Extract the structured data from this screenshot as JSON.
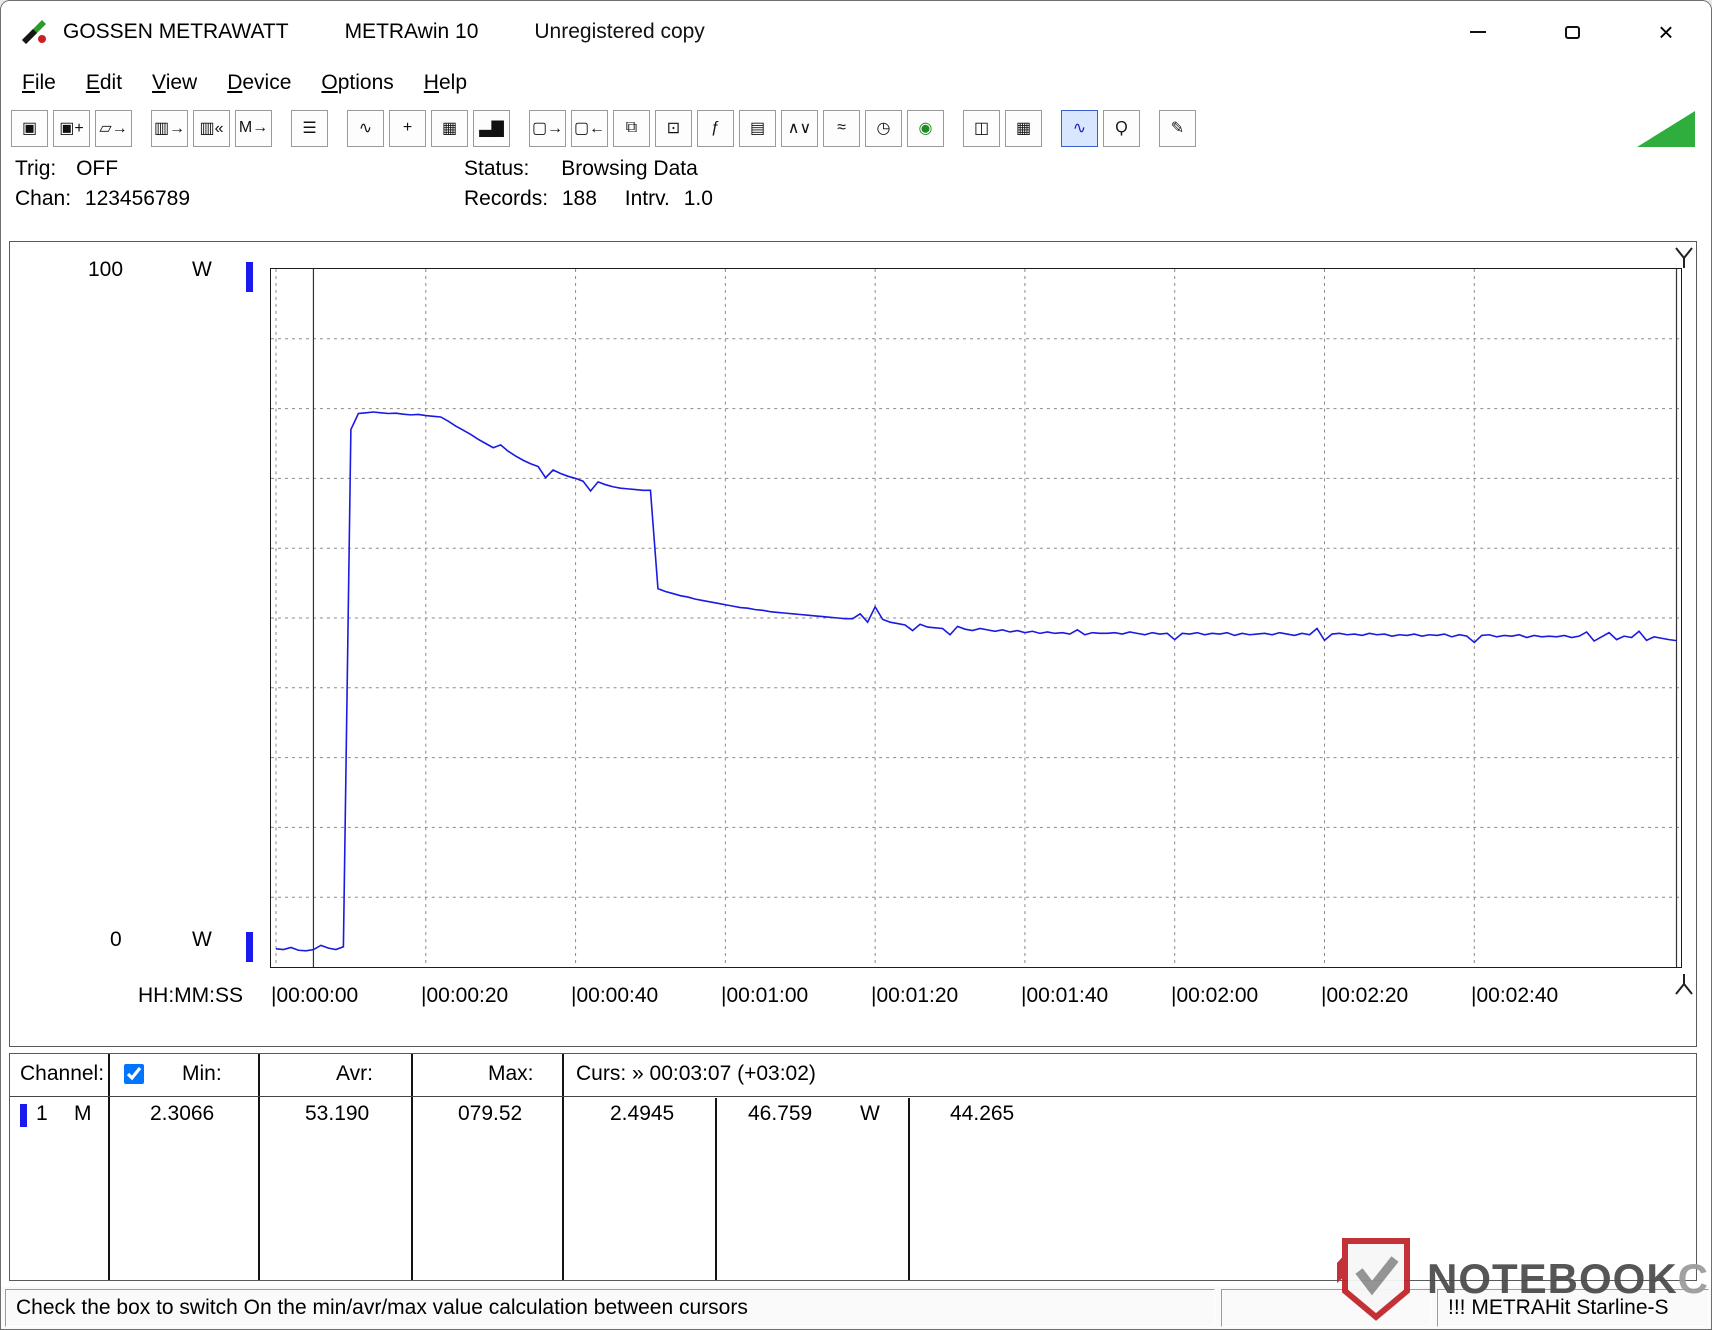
{
  "window": {
    "brand": "GOSSEN METRAWATT",
    "app": "METRAwin 10",
    "note": "Unregistered copy",
    "close_glyph": "×"
  },
  "menu": {
    "items": [
      "File",
      "Edit",
      "View",
      "Device",
      "Options",
      "Help"
    ]
  },
  "toolbar": {
    "groups": [
      {
        "buttons": [
          {
            "name": "save",
            "glyph": "▣"
          },
          {
            "name": "save-as",
            "glyph": "▣+"
          },
          {
            "name": "open-file",
            "glyph": "▱→"
          }
        ]
      },
      {
        "buttons": [
          {
            "name": "export-device",
            "glyph": "▥→"
          },
          {
            "name": "export-30k",
            "glyph": "▥«"
          },
          {
            "name": "export-memory",
            "glyph": "M→"
          }
        ]
      },
      {
        "buttons": [
          {
            "name": "keyboard",
            "glyph": "☰"
          }
        ]
      },
      {
        "buttons": [
          {
            "name": "chart-line-view",
            "glyph": "∿"
          },
          {
            "name": "crosshair-view",
            "glyph": "+"
          },
          {
            "name": "table-view",
            "glyph": "▦"
          },
          {
            "name": "bar-chart-view",
            "glyph": "▃▇"
          }
        ]
      },
      {
        "buttons": [
          {
            "name": "window-export",
            "glyph": "▢→"
          },
          {
            "name": "window-import",
            "glyph": "▢←"
          },
          {
            "name": "window-cascade",
            "glyph": "⧉"
          },
          {
            "name": "monitor",
            "glyph": "⊡"
          },
          {
            "name": "formula",
            "glyph": "ƒ"
          },
          {
            "name": "device-read",
            "glyph": "▤"
          },
          {
            "name": "wave-split",
            "glyph": "∧∨"
          },
          {
            "name": "wave",
            "glyph": "≈"
          },
          {
            "name": "device-timer",
            "glyph": "◷"
          },
          {
            "name": "device-status",
            "glyph": "◉",
            "color": "#1f8a1f"
          }
        ]
      },
      {
        "buttons": [
          {
            "name": "print-preview",
            "glyph": "◫"
          },
          {
            "name": "print",
            "glyph": "▦"
          }
        ]
      },
      {
        "buttons": [
          {
            "name": "zoom-wave",
            "glyph": "∿",
            "color": "#1a1acc",
            "active": true
          },
          {
            "name": "zoom-search",
            "glyph": "Ϙ"
          }
        ]
      },
      {
        "buttons": [
          {
            "name": "annotation",
            "glyph": "✎"
          }
        ]
      }
    ]
  },
  "info": {
    "trig_label": "Trig:",
    "trig_value": "OFF",
    "chan_label": "Chan:",
    "chan_value": "123456789",
    "status_label": "Status:",
    "status_value": "Browsing Data",
    "records_label": "Records:",
    "records_value": "188",
    "interval_label": "Intrv.",
    "interval_value": "1.0"
  },
  "chart": {
    "y_top_value": "100",
    "y_top_unit": "W",
    "y_bottom_value": "0",
    "y_bottom_unit": "W",
    "x_axis_label": "HH:MM:SS",
    "line_color": "#1a1ae0",
    "grid_color": "#8a8a8a"
  },
  "chart_data": {
    "type": "line",
    "title": "",
    "xlabel": "HH:MM:SS",
    "ylabel": "W",
    "ylim": [
      0,
      100
    ],
    "xlim_seconds": [
      0,
      187
    ],
    "grid": true,
    "x_tick_seconds": [
      0,
      20,
      40,
      60,
      80,
      100,
      120,
      140,
      160
    ],
    "x_tick_labels": [
      "00:00:00",
      "00:00:20",
      "00:00:40",
      "00:01:00",
      "00:01:20",
      "00:01:40",
      "00:02:00",
      "00:02:20",
      "00:02:40"
    ],
    "interval_s": 1,
    "cursors": {
      "cursor1_s": 5,
      "cursor2_s": 187
    },
    "series": [
      {
        "name": "Channel 1 power (W)",
        "values_w": [
          2.6,
          2.5,
          2.8,
          2.4,
          2.31,
          2.49,
          3.1,
          2.7,
          2.5,
          2.9,
          77.0,
          79.3,
          79.4,
          79.52,
          79.4,
          79.3,
          79.35,
          79.2,
          79.1,
          79.15,
          79.0,
          78.9,
          78.8,
          78.2,
          77.5,
          76.9,
          76.3,
          75.6,
          75.0,
          74.4,
          74.8,
          73.9,
          73.2,
          72.6,
          72.1,
          71.7,
          70.1,
          71.2,
          70.7,
          70.3,
          70.0,
          69.6,
          68.2,
          69.5,
          69.1,
          68.8,
          68.6,
          68.5,
          68.4,
          68.3,
          68.3,
          54.2,
          53.8,
          53.5,
          53.2,
          53.0,
          52.7,
          52.5,
          52.3,
          52.1,
          51.9,
          51.7,
          51.5,
          51.4,
          51.2,
          51.1,
          50.9,
          50.8,
          50.7,
          50.6,
          50.5,
          50.4,
          50.3,
          50.2,
          50.1,
          50.0,
          49.9,
          49.9,
          50.6,
          49.4,
          51.6,
          49.8,
          49.4,
          49.2,
          49.0,
          48.2,
          49.1,
          48.7,
          48.6,
          48.5,
          47.6,
          48.8,
          48.4,
          48.2,
          48.5,
          48.3,
          48.1,
          48.3,
          48.0,
          48.2,
          47.9,
          48.1,
          47.8,
          48.0,
          47.8,
          47.9,
          47.7,
          48.3,
          47.6,
          47.9,
          47.8,
          47.8,
          47.9,
          47.7,
          48.0,
          47.8,
          47.6,
          47.9,
          47.7,
          47.8,
          46.9,
          47.8,
          47.7,
          47.9,
          47.6,
          47.8,
          47.7,
          47.9,
          47.5,
          47.8,
          47.6,
          47.7,
          47.8,
          47.6,
          47.9,
          47.7,
          47.5,
          47.8,
          47.6,
          48.5,
          46.8,
          47.7,
          47.8,
          47.6,
          47.7,
          47.5,
          47.8,
          47.6,
          47.7,
          47.4,
          47.6,
          47.5,
          47.7,
          47.4,
          47.6,
          47.5,
          47.7,
          47.3,
          47.6,
          47.4,
          46.5,
          47.5,
          47.6,
          47.3,
          47.5,
          47.4,
          47.6,
          47.2,
          47.5,
          47.3,
          47.4,
          47.3,
          47.5,
          47.2,
          47.4,
          48.0,
          46.7,
          47.3,
          47.9,
          46.9,
          47.4,
          47.2,
          48.1,
          46.8,
          47.3,
          47.1,
          46.9,
          46.76
        ]
      }
    ]
  },
  "table": {
    "header": {
      "channel": "Channel:",
      "checkbox_checked": true,
      "min": "Min:",
      "avr": "Avr:",
      "max": "Max:",
      "curs": "Curs: » 00:03:07 (+03:02)"
    },
    "row": {
      "channel": "1",
      "type": "M",
      "min": "2.3066",
      "avr": "53.190",
      "max": "079.52",
      "curs1": "2.4945",
      "curs2": "46.759",
      "curs2_unit": "W",
      "delta": "44.265"
    }
  },
  "statusbar": {
    "message": "Check the box to switch On the min/avr/max value calculation between cursors",
    "device": "!!! METRAHit Starline-S"
  },
  "watermark": {
    "primary": "NOTEBOOK",
    "secondary": "CHECK"
  }
}
